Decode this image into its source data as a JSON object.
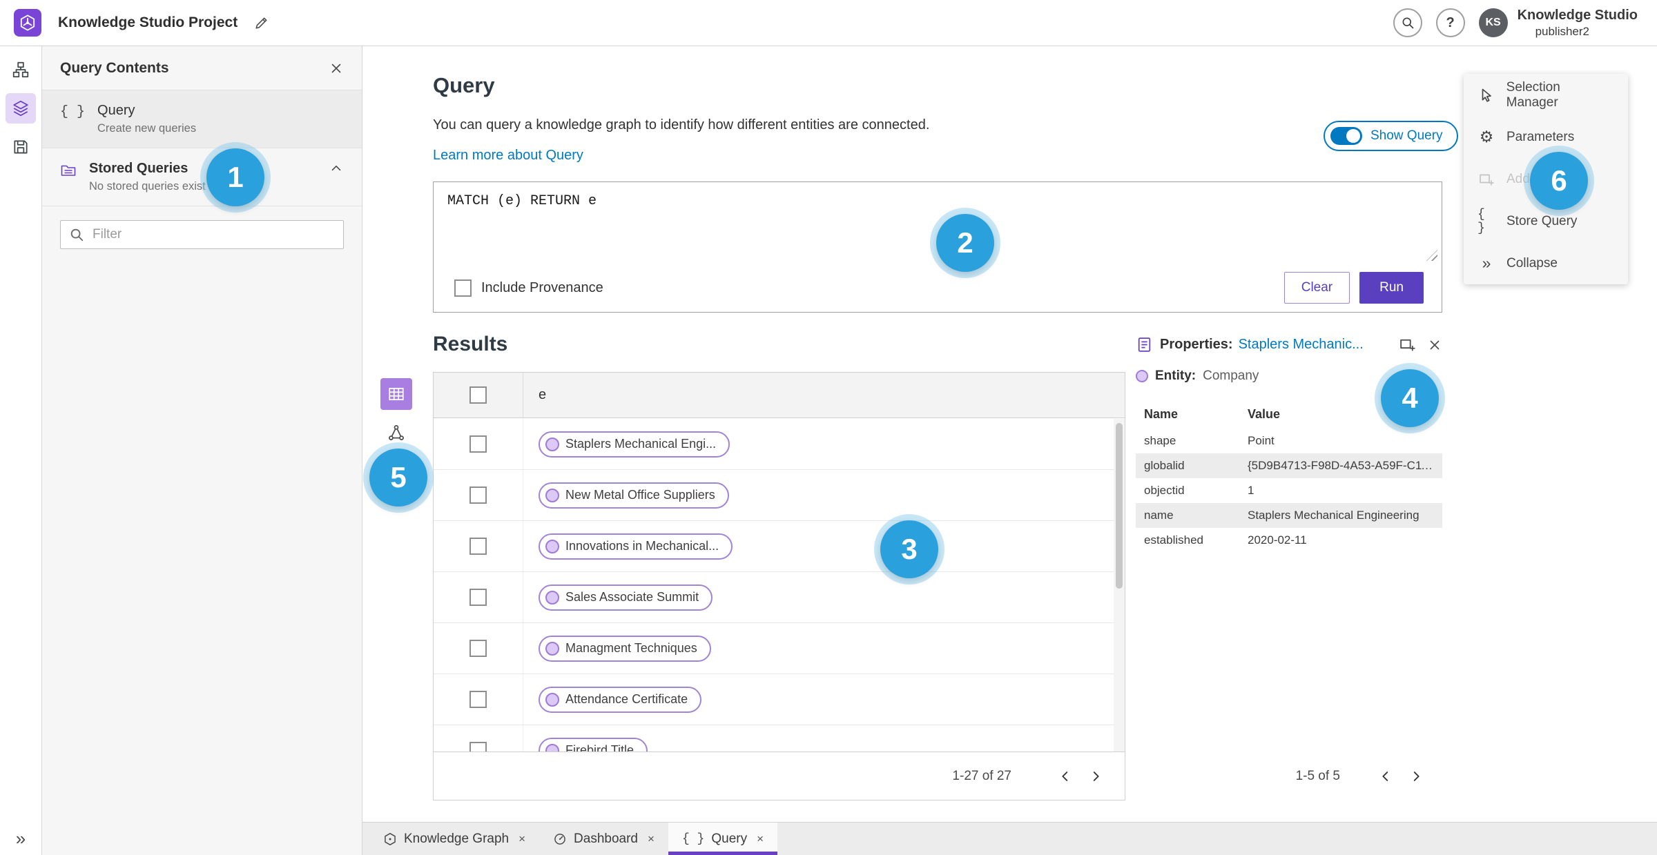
{
  "colors": {
    "purple": "#6a3fc4",
    "run_button": "#5a3fbf",
    "blue": "#0079c1",
    "badge_blue": "#2aa1dc"
  },
  "topbar": {
    "app_title": "Knowledge Studio Project",
    "help_glyph": "?",
    "user_initials": "KS",
    "user_name": "Knowledge Studio",
    "user_role": "publisher2"
  },
  "left_panel": {
    "title": "Query Contents",
    "query_item": {
      "label": "Query",
      "sublabel": "Create new queries",
      "icon_glyph": "{ }"
    },
    "stored_item": {
      "label": "Stored Queries",
      "sublabel": "No stored queries exist"
    },
    "filter_placeholder": "Filter"
  },
  "query": {
    "heading": "Query",
    "description": "You can query a knowledge graph to identify how different entities are connected.",
    "learn_more": "Learn more about Query",
    "show_query_label": "Show Query",
    "code": "MATCH (e) RETURN e",
    "include_provenance": "Include Provenance",
    "clear_label": "Clear",
    "run_label": "Run"
  },
  "results": {
    "heading": "Results",
    "column_header": "e",
    "rows": [
      "Staplers Mechanical Engi...",
      "New Metal Office Suppliers",
      "Innovations in Mechanical...",
      "Sales Associate Summit",
      "Managment Techniques",
      "Attendance Certificate",
      "Firebird Title"
    ],
    "pagination": "1-27 of 27"
  },
  "properties": {
    "label": "Properties:",
    "link": "Staplers Mechanic...",
    "entity_label": "Entity:",
    "entity_value": "Company",
    "col_name": "Name",
    "col_value": "Value",
    "rows": [
      [
        "shape",
        "Point"
      ],
      [
        "globalid",
        "{5D9B4713-F98D-4A53-A59F-C11..."
      ],
      [
        "objectid",
        "1"
      ],
      [
        "name",
        "Staplers Mechanical Engineering"
      ],
      [
        "established",
        "2020-02-11"
      ]
    ],
    "pagination": "1-5 of 5"
  },
  "right_menu": {
    "items": [
      "Selection Manager",
      "Parameters",
      "Add To Map",
      "Store Query",
      "Collapse"
    ],
    "store_query_glyph": "{ }",
    "collapse_glyph": "»"
  },
  "rail": {
    "expand_glyph": "»"
  },
  "tabs": [
    {
      "label": "Knowledge Graph"
    },
    {
      "label": "Dashboard"
    },
    {
      "label": "Query"
    }
  ],
  "close_glyph": "×",
  "badges": [
    "1",
    "2",
    "3",
    "4",
    "5",
    "6"
  ]
}
